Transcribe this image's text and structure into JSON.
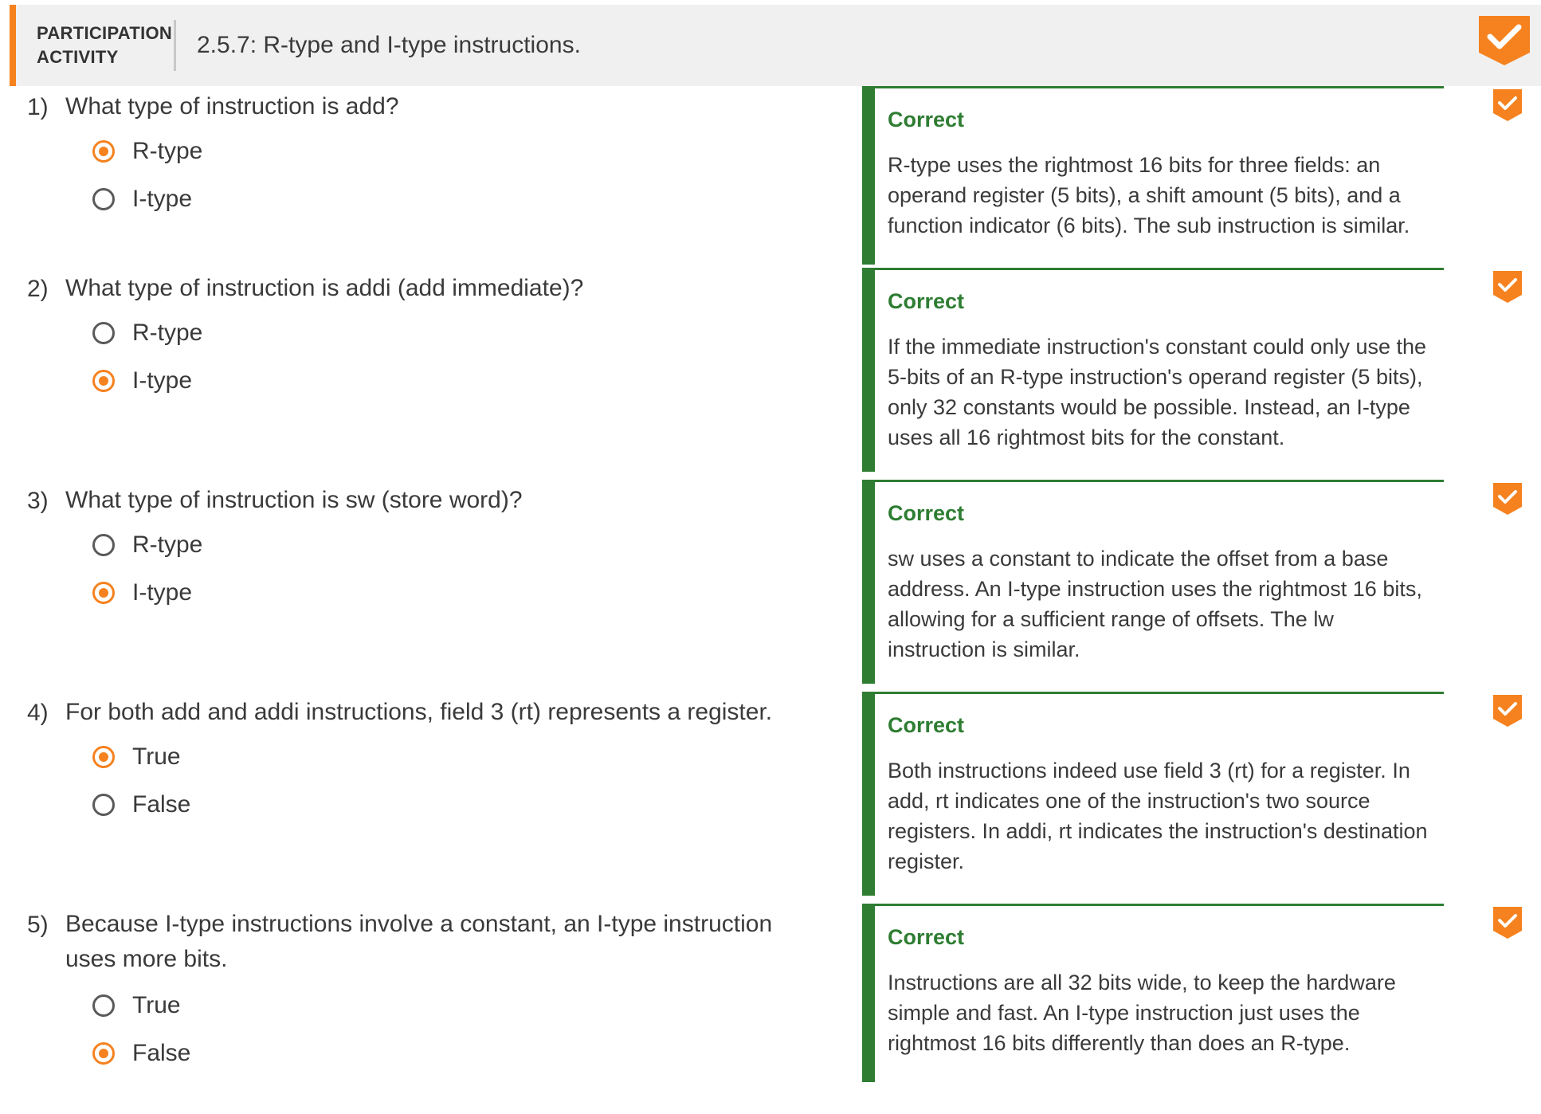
{
  "header": {
    "label": "PARTICIPATION\nACTIVITY",
    "label_line1": "PARTICIPATION",
    "label_line2": "ACTIVITY",
    "title": "2.5.7: R-type and I-type instructions.",
    "completed_icon": "check-badge-icon"
  },
  "colors": {
    "accent": "#f5821f",
    "correct": "#2e7d32",
    "header_bg": "#f0f0f0"
  },
  "questions": [
    {
      "number": "1)",
      "text": "What type of instruction is add?",
      "options": [
        {
          "label": "R-type",
          "selected": true
        },
        {
          "label": "I-type",
          "selected": false
        }
      ],
      "feedback": {
        "title": "Correct",
        "text": "R-type uses the rightmost 16 bits for three fields: an operand register (5 bits), a shift amount (5 bits), and a function indicator (6 bits). The sub instruction is similar."
      }
    },
    {
      "number": "2)",
      "text": "What type of instruction is addi (add immediate)?",
      "options": [
        {
          "label": "R-type",
          "selected": false
        },
        {
          "label": "I-type",
          "selected": true
        }
      ],
      "feedback": {
        "title": "Correct",
        "text": "If the immediate instruction's constant could only use the 5-bits of an R-type instruction's operand register (5 bits), only 32 constants would be possible. Instead, an I-type uses all 16 rightmost bits for the constant."
      }
    },
    {
      "number": "3)",
      "text": "What type of instruction is sw (store word)?",
      "options": [
        {
          "label": "R-type",
          "selected": false
        },
        {
          "label": "I-type",
          "selected": true
        }
      ],
      "feedback": {
        "title": "Correct",
        "text": "sw uses a constant to indicate the offset from a base address. An I-type instruction uses the rightmost 16 bits, allowing for a sufficient range of offsets. The lw instruction is similar."
      }
    },
    {
      "number": "4)",
      "text": "For both add and addi instructions, field 3 (rt) represents a register.",
      "options": [
        {
          "label": "True",
          "selected": true
        },
        {
          "label": "False",
          "selected": false
        }
      ],
      "feedback": {
        "title": "Correct",
        "text": "Both instructions indeed use field 3 (rt) for a register. In add, rt indicates one of the instruction's two source registers. In addi, rt indicates the instruction's destination register."
      }
    },
    {
      "number": "5)",
      "text": "Because I-type instructions involve a constant, an I-type instruction uses more bits.",
      "options": [
        {
          "label": "True",
          "selected": false
        },
        {
          "label": "False",
          "selected": true
        }
      ],
      "feedback": {
        "title": "Correct",
        "text": "Instructions are all 32 bits wide, to keep the hardware simple and fast. An I-type instruction just uses the rightmost 16 bits differently than does an R-type."
      }
    }
  ]
}
